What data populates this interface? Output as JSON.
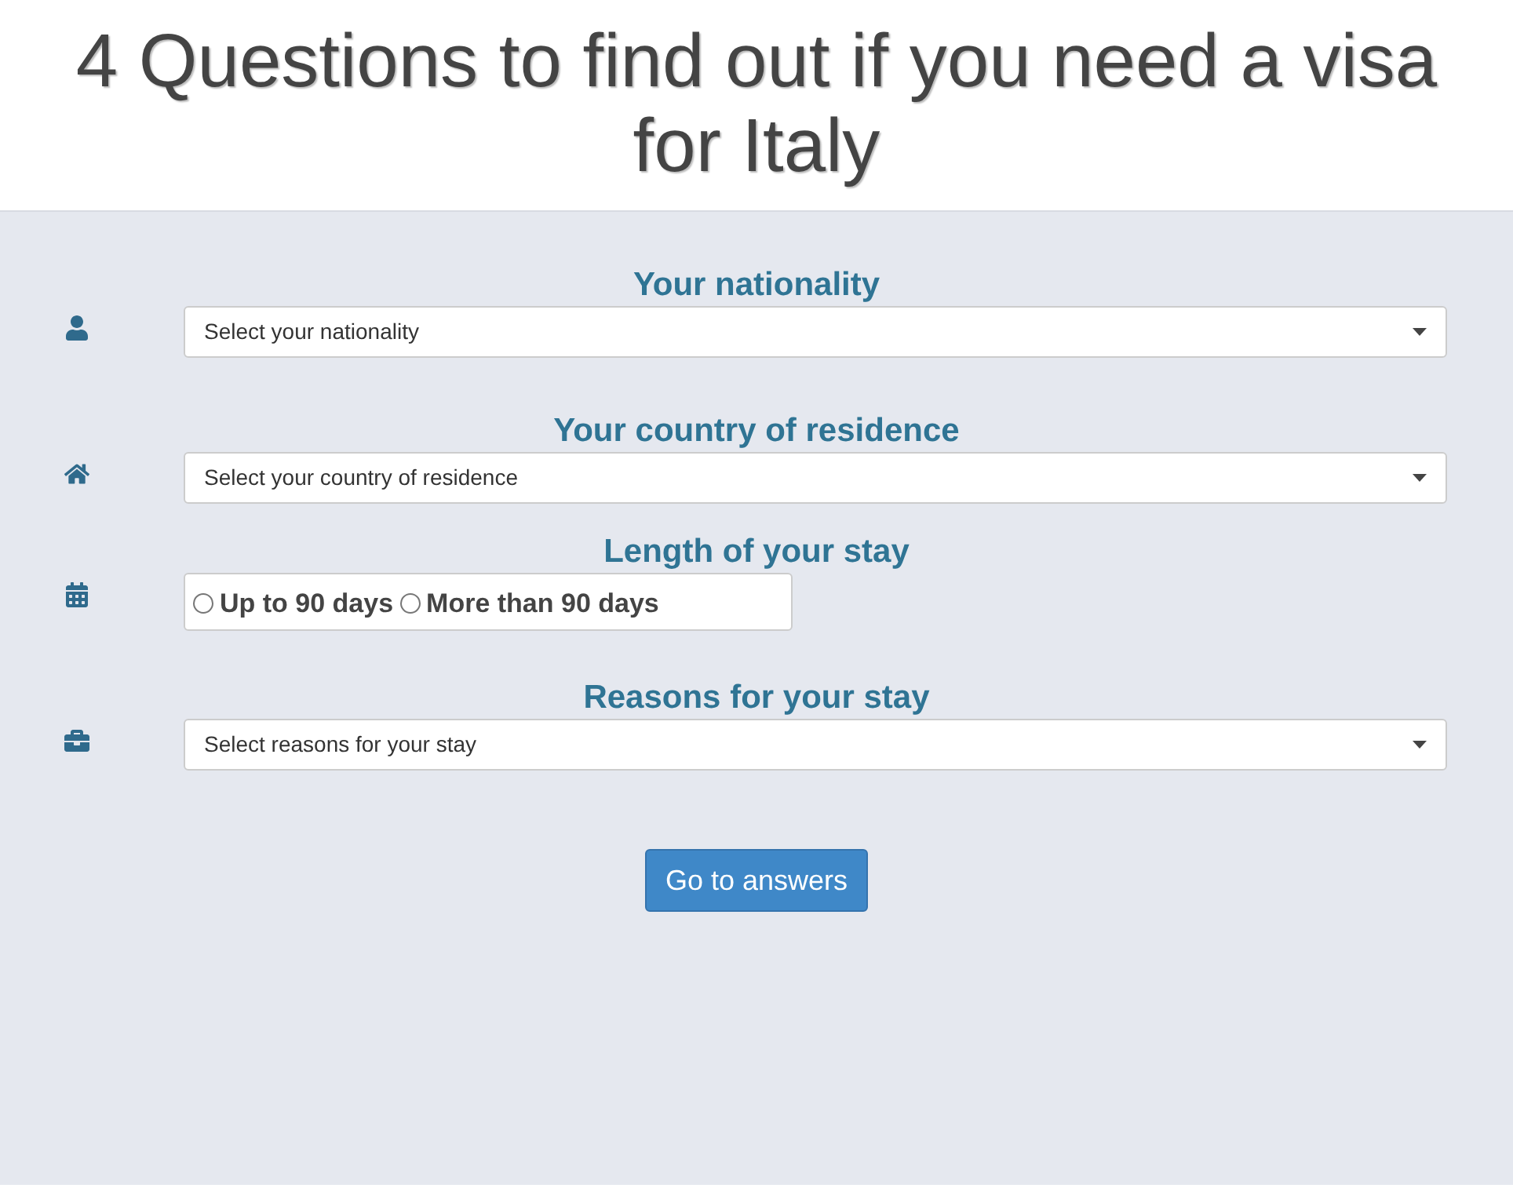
{
  "title": "4 Questions to find out if you need a visa for Italy",
  "questions": [
    {
      "kind": "select",
      "heading": "Your nationality",
      "placeholder": "Select your nationality"
    },
    {
      "kind": "select",
      "heading": "Your country of residence",
      "placeholder": "Select your country of residence"
    },
    {
      "kind": "radios",
      "heading": "Length of your stay",
      "options": [
        {
          "label": "Up to 90 days",
          "selected": false
        },
        {
          "label": "More than 90 days",
          "selected": false
        }
      ]
    },
    {
      "kind": "select",
      "heading": "Reasons for your stay",
      "placeholder": "Select reasons for your stay"
    }
  ],
  "submit": "Go to answers"
}
